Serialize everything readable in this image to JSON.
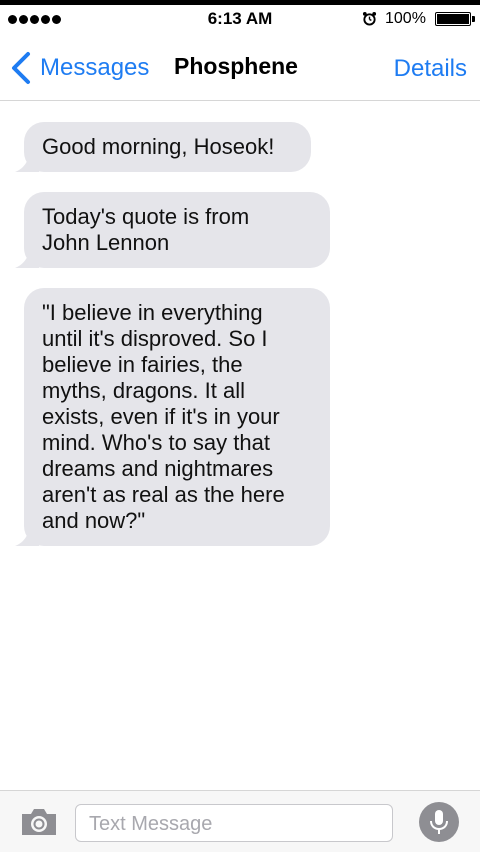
{
  "status_bar": {
    "time": "6:13 AM",
    "battery_percent": "100%",
    "battery_level": 1.0,
    "signal_bars": 5,
    "icons": [
      "signal-dots-icon",
      "alarm-icon",
      "battery-icon"
    ]
  },
  "nav": {
    "back_label": "Messages",
    "title": "Phosphene",
    "details_label": "Details"
  },
  "messages": [
    {
      "text": "Good morning, Hoseok!",
      "lines": [
        "Good morning, Hoseok!"
      ]
    },
    {
      "text": "Today's quote is from John Lennon",
      "lines": [
        "Today's quote is from",
        "John Lennon"
      ]
    },
    {
      "text": "\"I believe in everything until it's disproved. So I believe in fairies, the myths, dragons. It all exists, even if it's in your mind. Who's to say that dreams and nightmares aren't as real as the here and now?\"",
      "lines": [
        "\"I believe in everything",
        "until it's disproved. So I",
        "believe in fairies, the",
        "myths, dragons. It all",
        "exists, even if it's in your",
        "mind. Who's to say that",
        "dreams and nightmares",
        "aren't as real as the here",
        "and now?\""
      ]
    }
  ],
  "composer": {
    "placeholder": "Text Message",
    "icons": [
      "camera-icon",
      "microphone-icon"
    ]
  },
  "colors": {
    "accent": "#1e7cf2",
    "bubble": "#e5e5ea",
    "mic_button": "#8e8e93"
  }
}
